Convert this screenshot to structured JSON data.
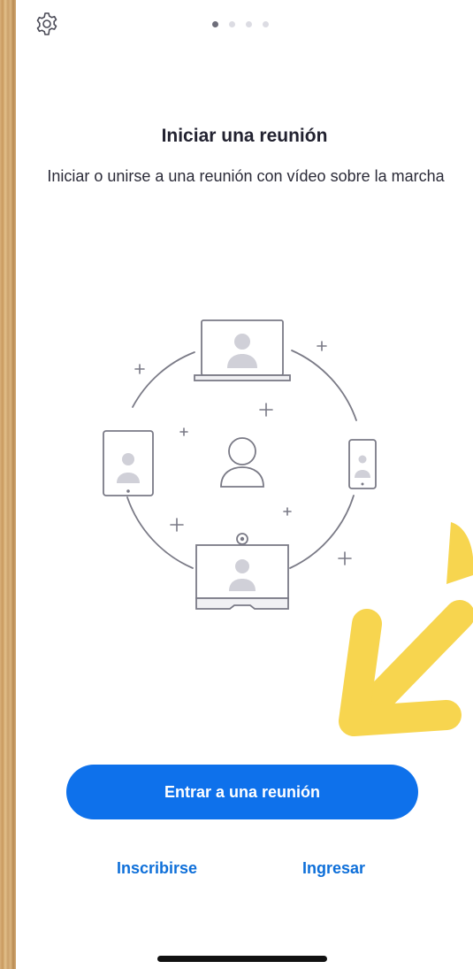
{
  "onboarding": {
    "page_indicator": {
      "total": 4,
      "current": 1
    },
    "title": "Iniciar una reunión",
    "subtitle": "Iniciar o unirse a una reunión con vídeo sobre la marcha",
    "illustration_icon": "meeting-devices-illustration"
  },
  "actions": {
    "join_label": "Entrar a una reunión",
    "signup_label": "Inscribirse",
    "signin_label": "Ingresar"
  },
  "icons": {
    "settings": "gear-icon",
    "annotation": "arrow-annotation-icon"
  },
  "colors": {
    "accent": "#0e71eb",
    "link": "#0e6fd9",
    "annotation": "#f7d54f",
    "illustration_stroke": "#7a7a86"
  }
}
